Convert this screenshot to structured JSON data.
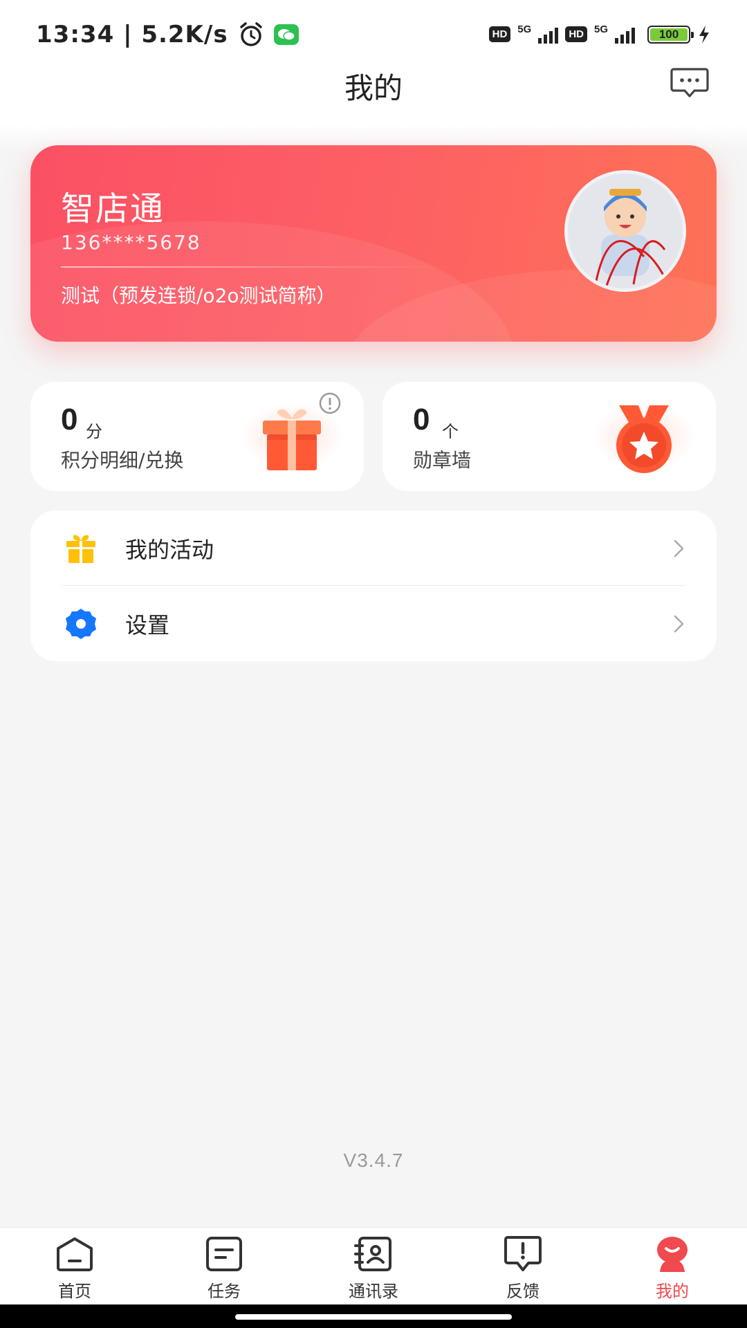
{
  "status_bar": {
    "time_speed": "13:34 | 5.2K/s",
    "network_1": "5G",
    "network_2": "5G",
    "hd_1": "HD",
    "hd_2": "HD",
    "battery": "100"
  },
  "header": {
    "title": "我的"
  },
  "profile": {
    "name": "智店通",
    "phone": "136****5678",
    "org": "测试（预发连锁/o2o测试简称）"
  },
  "stats": {
    "points": {
      "value": "0",
      "unit": "分",
      "label": "积分明细/兑换"
    },
    "medals": {
      "value": "0",
      "unit": "个",
      "label": "勋章墙"
    }
  },
  "menu": {
    "activity_label": "我的活动",
    "settings_label": "设置"
  },
  "version": "V3.4.7",
  "bottom_nav": {
    "items": [
      {
        "label": "首页",
        "icon": "home-icon"
      },
      {
        "label": "任务",
        "icon": "task-icon"
      },
      {
        "label": "通讯录",
        "icon": "contacts-icon"
      },
      {
        "label": "反馈",
        "icon": "feedback-icon"
      },
      {
        "label": "我的",
        "icon": "profile-icon",
        "active": true
      }
    ]
  },
  "colors": {
    "accent": "#f0494e",
    "card_gradient_start": "#fb5064",
    "card_gradient_end": "#fe7156",
    "settings_icon": "#1677ff",
    "activity_icon": "#ffc107"
  }
}
